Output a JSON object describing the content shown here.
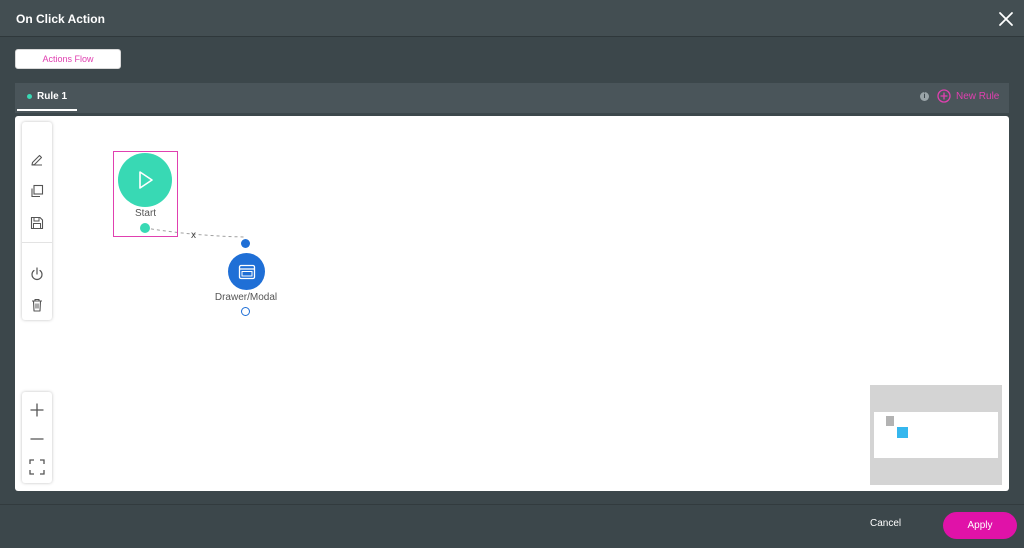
{
  "dialog": {
    "title": "On Click Action"
  },
  "flow_tab": {
    "label": "Actions Flow"
  },
  "rules": {
    "tabs": [
      {
        "label": "Rule 1"
      }
    ],
    "info_glyph": "i",
    "new_rule_label": "New Rule"
  },
  "toolbar": {
    "tools": [
      "edit-icon",
      "copy-icon",
      "save-icon",
      "power-icon",
      "delete-icon"
    ],
    "zoom": [
      "zoom-in-icon",
      "zoom-out-icon",
      "fit-screen-icon"
    ]
  },
  "nodes": {
    "start": {
      "label": "Start"
    },
    "drawer_modal": {
      "label": "Drawer/Modal"
    },
    "connector_remove": "x"
  },
  "footer": {
    "cancel_label": "Cancel",
    "apply_label": "Apply"
  },
  "colors": {
    "accent": "#e012a8",
    "start_node": "#38d9b4",
    "action_node": "#1f6fd6",
    "minimap_node": "#35b7ee"
  }
}
